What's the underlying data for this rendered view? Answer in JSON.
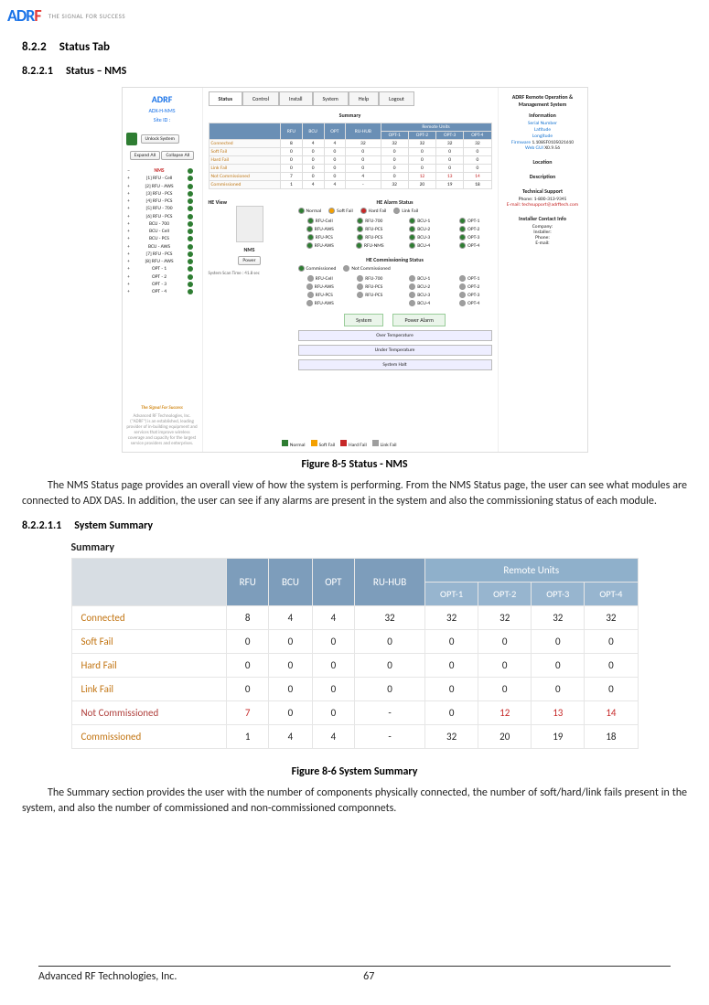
{
  "logo": {
    "letters": [
      "A",
      "D",
      "R",
      "F"
    ],
    "tagline": "THE SIGNAL FOR SUCCESS"
  },
  "headings": {
    "s1_num": "8.2.2",
    "s1_title": "Status Tab",
    "s2_num": "8.2.2.1",
    "s2_title": "Status – NMS",
    "s3_num": "8.2.2.1.1",
    "s3_title": "System Summary"
  },
  "fig85": {
    "caption": "Figure 8-5     Status - NMS",
    "sidebar": {
      "logo": "ADRF",
      "product": "ADX-H-NMS",
      "site_label": "Site ID :",
      "unlock": "Unlock System",
      "expand": "Expand All",
      "collapse": "Collapse All",
      "tree_root": "NMS",
      "tree": [
        "[1] RFU - Cell",
        "[2] RFU - AWS",
        "[3] RFU - PCS",
        "[4] RFU - PCS",
        "[5] RFU - 700",
        "[6] RFU - PCS",
        "BCU - 700",
        "BCU - Cell",
        "BCU - PCS",
        "BCU - AWS",
        "[7] RFU - PCS",
        "[8] RFU - AWS",
        "OPT - 1",
        "OPT - 2",
        "OPT - 3",
        "OPT - 4"
      ],
      "tagline": "The Signal For Success",
      "blurb": "Advanced RF Technologies, Inc. (\"ADRF\") is an established, leading provider of in-building equipment and services that improve wireless coverage and capacity for the largest service providers and enterprises."
    },
    "tabs": [
      "Status",
      "Control",
      "Install",
      "System",
      "Help",
      "Logout"
    ],
    "summary_label": "Summary",
    "cols_top": [
      "RFU",
      "BCU",
      "OPT",
      "RU-HUB"
    ],
    "remote_label": "Remote Units",
    "cols_ru": [
      "OPT-1",
      "OPT-2",
      "OPT-3",
      "OPT-4"
    ],
    "rows": [
      {
        "label": "Connected",
        "v": [
          "8",
          "4",
          "4",
          "32",
          "32",
          "32",
          "32",
          "32"
        ]
      },
      {
        "label": "Soft Fail",
        "v": [
          "0",
          "0",
          "0",
          "0",
          "0",
          "0",
          "0",
          "0"
        ]
      },
      {
        "label": "Hard Fail",
        "v": [
          "0",
          "0",
          "0",
          "0",
          "0",
          "0",
          "0",
          "0"
        ]
      },
      {
        "label": "Link Fail",
        "v": [
          "0",
          "0",
          "0",
          "0",
          "0",
          "0",
          "0",
          "0"
        ]
      },
      {
        "label": "Not Commissioned",
        "v": [
          "7",
          "0",
          "0",
          "4",
          "0",
          "12",
          "13",
          "14"
        ],
        "red": [
          5,
          6,
          7
        ]
      },
      {
        "label": "Commissioned",
        "v": [
          "1",
          "4",
          "4",
          "-",
          "32",
          "20",
          "19",
          "18"
        ]
      }
    ],
    "heview": {
      "title": "HE View",
      "label": "NMS",
      "power": "Power",
      "scan": "System Scan Time : 41.8 sec"
    },
    "alarm": {
      "title": "HE Alarm Status",
      "legend": [
        "Normal",
        "Soft Fail",
        "Hard Fail",
        "Link Fail"
      ],
      "items": [
        "RFU-Cell",
        "RFU-700",
        "BCU-1",
        "OPT-1",
        "RFU-AWS",
        "RFU-PCS",
        "BCU-2",
        "OPT-2",
        "RFU-PCS",
        "RFU-PCS",
        "BCU-3",
        "OPT-3",
        "RFU-AWS",
        "RFU-NMS",
        "BCU-4",
        "OPT-4"
      ]
    },
    "commission": {
      "title": "HE Commissioning Status",
      "legend": [
        "Commissioned",
        "Not Commissioned"
      ],
      "items": [
        "RFU-Cell",
        "RFU-700",
        "BCU-1",
        "OPT-1",
        "RFU-AWS",
        "RFU-PCS",
        "BCU-2",
        "OPT-2",
        "RFU-PCS",
        "RFU-PCS",
        "BCU-3",
        "OPT-3",
        "RFU-AWS",
        "",
        "BCU-4",
        "OPT-4"
      ]
    },
    "btm_buttons": [
      "System",
      "Power Alarm"
    ],
    "stack_labels": [
      "Over Temperature",
      "Under Temperature",
      "System Halt"
    ],
    "legend_footer": [
      "Normal",
      "Soft Fail",
      "Hard Fail",
      "Link Fail"
    ],
    "rightpanel": {
      "title": "ADRF Remote Operation & Management System",
      "info_hdr": "Information",
      "info_fields": [
        "Serial Number",
        "Latitude",
        "Longitude",
        "Firmware",
        "Web GUI"
      ],
      "firmware_val": "1.1085F0105021610",
      "webgui_val": "X0.9.56",
      "location_hdr": "Location",
      "desc_hdr": "Description",
      "support_hdr": "Technical Support",
      "support_phone": "Phone: 1-800-313-9345",
      "support_email": "E-mail: techsupport@adrftech.com",
      "installer_hdr": "Installer Contact Info",
      "installer_fields": [
        "Company:",
        "Installer:",
        "Phone:",
        "E-mail:"
      ]
    }
  },
  "para1": "The NMS Status page provides an overall view of how the system is performing.  From the NMS Status page, the user can see what modules are connected to ADX DAS.  In addition, the user can see if any alarms are present in the system and also the commissioning status of each module.",
  "fig86": {
    "caption": "Figure 8-6     System Summary",
    "title": "Summary",
    "cols_top": [
      "RFU",
      "BCU",
      "OPT",
      "RU-HUB"
    ],
    "remote_label": "Remote Units",
    "cols_ru": [
      "OPT-1",
      "OPT-2",
      "OPT-3",
      "OPT-4"
    ],
    "rows": [
      {
        "label": "Connected",
        "v": [
          "8",
          "4",
          "4",
          "32",
          "32",
          "32",
          "32",
          "32"
        ]
      },
      {
        "label": "Soft Fail",
        "v": [
          "0",
          "0",
          "0",
          "0",
          "0",
          "0",
          "0",
          "0"
        ]
      },
      {
        "label": "Hard Fail",
        "v": [
          "0",
          "0",
          "0",
          "0",
          "0",
          "0",
          "0",
          "0"
        ]
      },
      {
        "label": "Link Fail",
        "v": [
          "0",
          "0",
          "0",
          "0",
          "0",
          "0",
          "0",
          "0"
        ]
      },
      {
        "label": "Not Commissioned",
        "nc": true,
        "v": [
          "7",
          "0",
          "0",
          "-",
          "0",
          "12",
          "13",
          "14"
        ],
        "red": [
          0,
          5,
          6,
          7
        ]
      },
      {
        "label": "Commissioned",
        "v": [
          "1",
          "4",
          "4",
          "-",
          "32",
          "20",
          "19",
          "18"
        ]
      }
    ]
  },
  "para2": "The Summary section provides the user with the number of components physically connected, the number of soft/hard/link fails present in the system, and also the number of commissioned and non-commissioned componnets.",
  "footer": {
    "company": "Advanced RF Technologies, Inc.",
    "page": "67"
  },
  "chart_data": {
    "type": "table",
    "title": "System Summary",
    "columns": [
      "",
      "RFU",
      "BCU",
      "OPT",
      "RU-HUB",
      "OPT-1",
      "OPT-2",
      "OPT-3",
      "OPT-4"
    ],
    "rows": [
      [
        "Connected",
        8,
        4,
        4,
        32,
        32,
        32,
        32,
        32
      ],
      [
        "Soft Fail",
        0,
        0,
        0,
        0,
        0,
        0,
        0,
        0
      ],
      [
        "Hard Fail",
        0,
        0,
        0,
        0,
        0,
        0,
        0,
        0
      ],
      [
        "Link Fail",
        0,
        0,
        0,
        0,
        0,
        0,
        0,
        0
      ],
      [
        "Not Commissioned",
        7,
        0,
        0,
        "-",
        0,
        12,
        13,
        14
      ],
      [
        "Commissioned",
        1,
        4,
        4,
        "-",
        32,
        20,
        19,
        18
      ]
    ]
  }
}
